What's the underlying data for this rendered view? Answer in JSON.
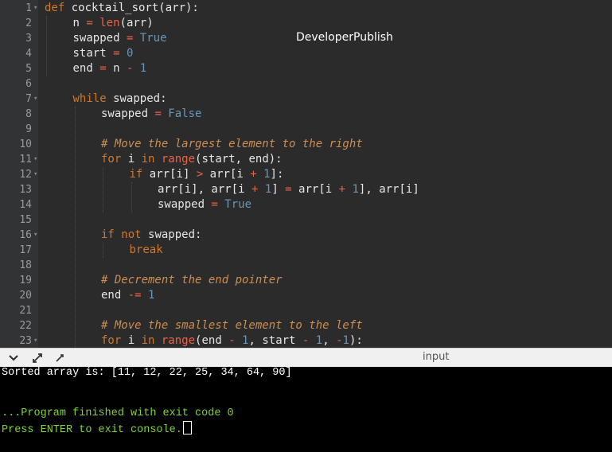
{
  "editor": {
    "watermark": "DeveloperPublish",
    "lines": [
      {
        "n": "1",
        "fold": true,
        "indent": 0,
        "tokens": [
          [
            "kw",
            "def "
          ],
          [
            "fn",
            "cocktail_sort(arr):"
          ]
        ]
      },
      {
        "n": "2",
        "fold": false,
        "indent": 1,
        "tokens": [
          [
            "",
            "n "
          ],
          [
            "op",
            "= "
          ],
          [
            "bi",
            "len"
          ],
          [
            "",
            "(arr)"
          ]
        ]
      },
      {
        "n": "3",
        "fold": false,
        "indent": 1,
        "tokens": [
          [
            "",
            "swapped "
          ],
          [
            "op",
            "= "
          ],
          [
            "const",
            "True"
          ]
        ]
      },
      {
        "n": "4",
        "fold": false,
        "indent": 1,
        "tokens": [
          [
            "",
            "start "
          ],
          [
            "op",
            "= "
          ],
          [
            "num",
            "0"
          ]
        ]
      },
      {
        "n": "5",
        "fold": false,
        "indent": 1,
        "tokens": [
          [
            "",
            "end "
          ],
          [
            "op",
            "= "
          ],
          [
            "",
            "n "
          ],
          [
            "op",
            "- "
          ],
          [
            "num",
            "1"
          ]
        ]
      },
      {
        "n": "6",
        "fold": false,
        "indent": 0,
        "tokens": []
      },
      {
        "n": "7",
        "fold": true,
        "indent": 1,
        "tokens": [
          [
            "kw",
            "while "
          ],
          [
            "",
            "swapped:"
          ]
        ]
      },
      {
        "n": "8",
        "fold": false,
        "indent": 2,
        "tokens": [
          [
            "",
            "swapped "
          ],
          [
            "op",
            "= "
          ],
          [
            "const",
            "False"
          ]
        ]
      },
      {
        "n": "9",
        "fold": false,
        "indent": 0,
        "tokens": []
      },
      {
        "n": "10",
        "fold": false,
        "indent": 2,
        "tokens": [
          [
            "cmt",
            "# Move the largest element to the right"
          ]
        ]
      },
      {
        "n": "11",
        "fold": true,
        "indent": 2,
        "tokens": [
          [
            "kw",
            "for "
          ],
          [
            "",
            "i "
          ],
          [
            "kw",
            "in "
          ],
          [
            "bi",
            "range"
          ],
          [
            "",
            "(start, end):"
          ]
        ]
      },
      {
        "n": "12",
        "fold": true,
        "indent": 3,
        "tokens": [
          [
            "kw",
            "if "
          ],
          [
            "",
            "arr[i] "
          ],
          [
            "op",
            "> "
          ],
          [
            "",
            "arr[i "
          ],
          [
            "op",
            "+ "
          ],
          [
            "num",
            "1"
          ],
          [
            "",
            "]:"
          ]
        ]
      },
      {
        "n": "13",
        "fold": false,
        "indent": 4,
        "tokens": [
          [
            "",
            "arr[i], arr[i "
          ],
          [
            "op",
            "+ "
          ],
          [
            "num",
            "1"
          ],
          [
            "",
            "] "
          ],
          [
            "op",
            "= "
          ],
          [
            "",
            "arr[i "
          ],
          [
            "op",
            "+ "
          ],
          [
            "num",
            "1"
          ],
          [
            "",
            "], arr[i]"
          ]
        ]
      },
      {
        "n": "14",
        "fold": false,
        "indent": 4,
        "tokens": [
          [
            "",
            "swapped "
          ],
          [
            "op",
            "= "
          ],
          [
            "const",
            "True"
          ]
        ]
      },
      {
        "n": "15",
        "fold": false,
        "indent": 0,
        "tokens": []
      },
      {
        "n": "16",
        "fold": true,
        "indent": 2,
        "tokens": [
          [
            "kw",
            "if not "
          ],
          [
            "",
            "swapped:"
          ]
        ]
      },
      {
        "n": "17",
        "fold": false,
        "indent": 3,
        "tokens": [
          [
            "kw",
            "break"
          ]
        ]
      },
      {
        "n": "18",
        "fold": false,
        "indent": 0,
        "tokens": []
      },
      {
        "n": "19",
        "fold": false,
        "indent": 2,
        "tokens": [
          [
            "cmt",
            "# Decrement the end pointer"
          ]
        ]
      },
      {
        "n": "20",
        "fold": false,
        "indent": 2,
        "tokens": [
          [
            "",
            "end "
          ],
          [
            "op",
            "-= "
          ],
          [
            "num",
            "1"
          ]
        ]
      },
      {
        "n": "21",
        "fold": false,
        "indent": 0,
        "tokens": []
      },
      {
        "n": "22",
        "fold": false,
        "indent": 2,
        "tokens": [
          [
            "cmt",
            "# Move the smallest element to the left"
          ]
        ]
      },
      {
        "n": "23",
        "fold": true,
        "indent": 2,
        "tokens": [
          [
            "kw",
            "for "
          ],
          [
            "",
            "i "
          ],
          [
            "kw",
            "in "
          ],
          [
            "bi",
            "range"
          ],
          [
            "",
            "(end "
          ],
          [
            "op",
            "- "
          ],
          [
            "num",
            "1"
          ],
          [
            "",
            ", start "
          ],
          [
            "op",
            "- "
          ],
          [
            "num",
            "1"
          ],
          [
            "",
            ", "
          ],
          [
            "op",
            "-"
          ],
          [
            "num",
            "1"
          ],
          [
            "",
            "):"
          ]
        ]
      }
    ]
  },
  "divider": {
    "input_label": "input",
    "icons": [
      "chevron-down-icon",
      "expand-icon",
      "settings-icon"
    ]
  },
  "console": {
    "output": "Sorted array is: [11, 12, 22, 25, 34, 64, 90]",
    "finished": "...Program finished with exit code 0",
    "prompt": "Press ENTER to exit console.",
    "colors": {
      "output": "#ffffff",
      "status": "#7fd13b"
    }
  }
}
